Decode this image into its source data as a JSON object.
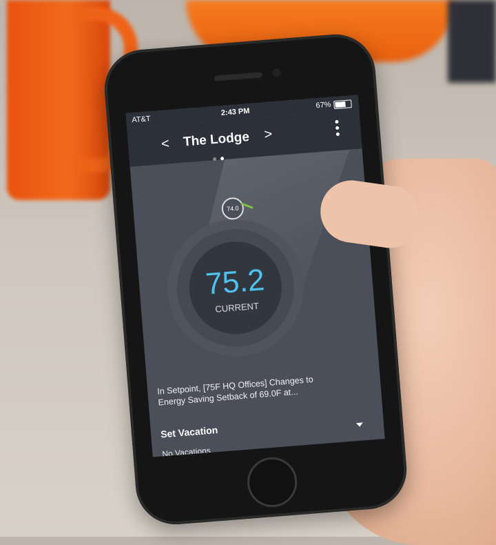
{
  "status_bar": {
    "carrier": "AT&T",
    "time": "2:43 PM",
    "battery": "67%"
  },
  "nav": {
    "back_label": "<",
    "title": "The Lodge",
    "forward_label": ">",
    "page_dots": 2,
    "active_dot": 1
  },
  "thermostat": {
    "current_temp": "75.2",
    "current_label": "CURRENT",
    "setpoint": "74.0",
    "temp_color": "#4fc1ec"
  },
  "schedule_message": "In Setpoint, [75F HQ Offices] Changes to Energy Saving Setback of 69.0F at...",
  "vacation": {
    "title": "Set Vacation",
    "value": "No Vacations"
  }
}
